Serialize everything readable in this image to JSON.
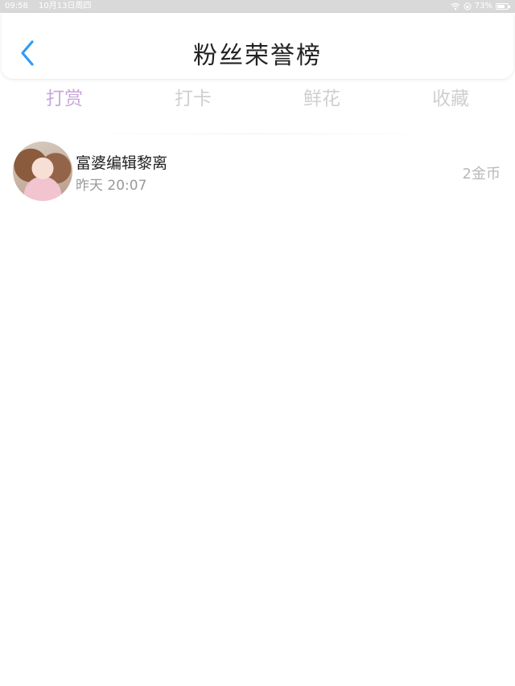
{
  "status_bar": {
    "time": "09:58",
    "date": "10月13日周四",
    "battery_text": "73%",
    "battery_level": 0.73,
    "wifi_icon": "wifi-icon",
    "lock_icon": "orientation-lock-icon"
  },
  "header": {
    "title": "粉丝荣誉榜",
    "back_icon": "chevron-left-icon",
    "accent_color": "#2f9df4"
  },
  "tabs": [
    {
      "label": "打赏",
      "active": true
    },
    {
      "label": "打卡",
      "active": false
    },
    {
      "label": "鲜花",
      "active": false
    },
    {
      "label": "收藏",
      "active": false
    }
  ],
  "colors": {
    "active_tab": "#c9a6dc",
    "inactive_tab": "#cfcfcf"
  },
  "list": [
    {
      "name": "富婆编辑黎离",
      "time": "昨天 20:07",
      "amount": "2金币"
    }
  ]
}
